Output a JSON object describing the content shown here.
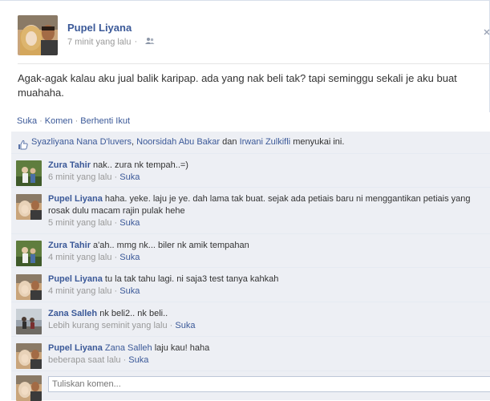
{
  "post": {
    "author": "Pupel Liyana",
    "time": "7 minit yang lalu",
    "text": "Agak-agak kalau aku jual balik karipap. ada yang nak beli tak? tapi seminggu sekali je aku buat muahaha.",
    "audience_icon": "friends-icon"
  },
  "actions": {
    "like": "Suka",
    "comment": "Komen",
    "unfollow": "Berhenti Ikut"
  },
  "likes": {
    "names": [
      "Syazliyana Nana D'luvers",
      "Noorsidah Abu Bakar",
      "Irwani Zulkifli"
    ],
    "and_word": "dan",
    "suffix": "menyukai ini."
  },
  "comments": [
    {
      "author": "Zura Tahir",
      "text": "nak.. zura nk tempah..=)",
      "time": "6 minit yang lalu",
      "like": "Suka"
    },
    {
      "author": "Pupel Liyana",
      "text": "haha. yeke. laju je ye. dah lama tak buat. sejak ada petiais baru ni menggantikan petiais yang rosak dulu macam rajin pulak hehe",
      "time": "5 minit yang lalu",
      "like": "Suka"
    },
    {
      "author": "Zura Tahir",
      "text": "a'ah.. mmg nk... biler nk amik tempahan",
      "time": "4 minit yang lalu",
      "like": "Suka"
    },
    {
      "author": "Pupel Liyana",
      "text": "tu la tak tahu lagi. ni saja3 test tanya kahkah",
      "time": "4 minit yang lalu",
      "like": "Suka"
    },
    {
      "author": "Zana Salleh",
      "text": "nk beli2.. nk beli..",
      "time": "Lebih kurang seminit yang lalu",
      "like": "Suka"
    },
    {
      "author": "Pupel Liyana",
      "text": "laju kau! haha",
      "mention": "Zana Salleh",
      "time": "beberapa saat lalu",
      "like": "Suka"
    }
  ],
  "composer": {
    "placeholder": "Tuliskan komen..."
  },
  "colors": {
    "link": "#3b5998",
    "ufi_bg": "#edeff4",
    "meta": "#999999"
  }
}
